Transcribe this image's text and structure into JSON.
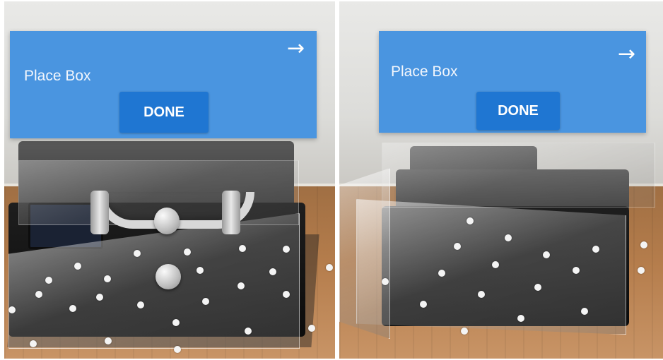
{
  "views": [
    {
      "name": "left-view",
      "card": {
        "title": "Place Box",
        "next_icon": "arrow-right-icon",
        "next_glyph": "→",
        "button_label": "DONE"
      }
    },
    {
      "name": "right-view",
      "card": {
        "title": "Place Box",
        "next_icon": "arrow-right-icon",
        "next_glyph": "→",
        "button_label": "DONE"
      }
    }
  ],
  "colors": {
    "card_background": "#4a95e0",
    "button_background": "#1f76d2",
    "button_text": "#ffffff"
  }
}
